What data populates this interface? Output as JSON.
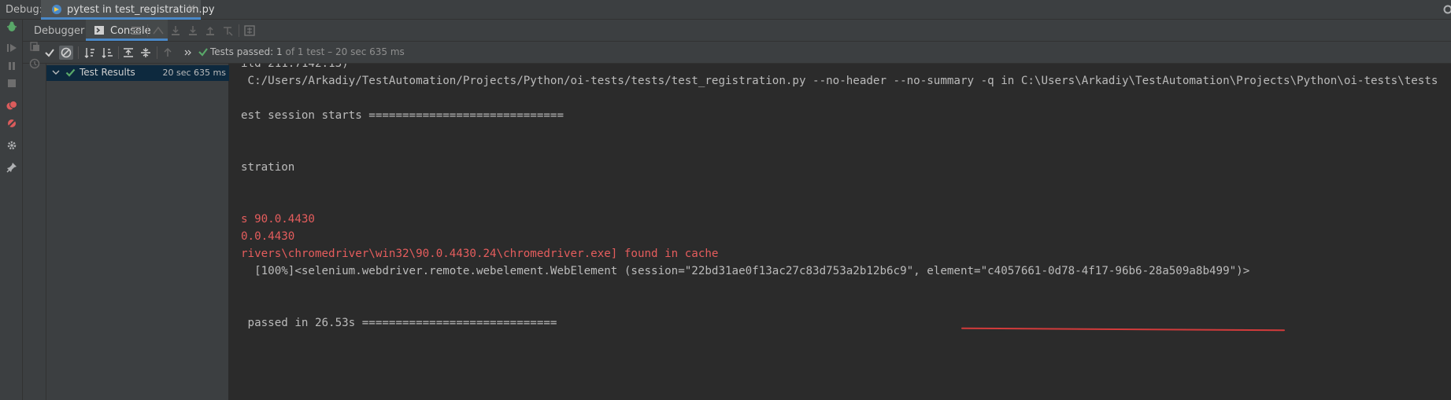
{
  "window": {
    "debug_label": "Debug:",
    "run_tab": {
      "title": "pytest in test_registration.py",
      "icon": "pytest-run-icon",
      "close": "×"
    }
  },
  "tabs": [
    {
      "label": "Debugger"
    },
    {
      "label": "Console",
      "icon": "console-icon"
    }
  ],
  "test_status": {
    "passed_label": "Tests passed: 1",
    "detail": " of 1 test – 20 sec 635 ms"
  },
  "tree": {
    "items": [
      {
        "label": "Test Results",
        "duration": "20 sec 635 ms"
      }
    ]
  },
  "console": {
    "lines": [
      {
        "text": "ild 211.7142.13)",
        "color": "normal"
      },
      {
        "text": " C:/Users/Arkadiy/TestAutomation/Projects/Python/oi-tests/tests/test_registration.py --no-header --no-summary -q in C:\\Users\\Arkadiy\\TestAutomation\\Projects\\Python\\oi-tests\\tests",
        "color": "normal"
      },
      {
        "text": "est session starts =============================",
        "color": "normal"
      },
      {
        "text": "stration",
        "color": "normal"
      },
      {
        "text": "s 90.0.4430",
        "color": "error"
      },
      {
        "text": "0.0.4430",
        "color": "error"
      },
      {
        "text": "rivers\\chromedriver\\win32\\90.0.4430.24\\chromedriver.exe] found in cache",
        "color": "error"
      },
      {
        "text": "  [100%]<selenium.webdriver.remote.webelement.WebElement (session=\"22bd31ae0f13ac27c83d753a2b12b6c9\", element=\"c4057661-0d78-4f17-96b6-28a509a8b499\")>",
        "color": "normal"
      },
      {
        "text": " passed in 26.53s =============================",
        "color": "normal"
      }
    ]
  },
  "colors": {
    "background": "#2b2b2b",
    "panel": "#3c3f41",
    "accent": "#4a88c7",
    "pass_green": "#59a869",
    "error_red": "#e55d5d",
    "annotation_red": "#d23b3b"
  }
}
